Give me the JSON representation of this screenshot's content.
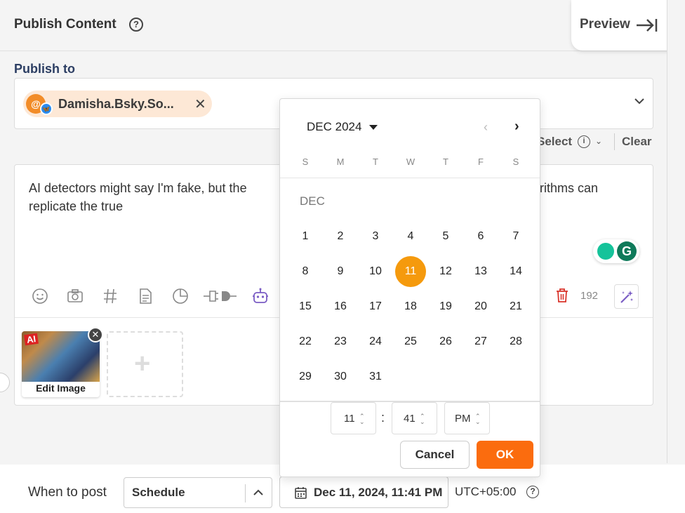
{
  "header": {
    "title": "Publish Content",
    "help_icon": "?",
    "preview_label": "Preview"
  },
  "publish_to": {
    "label": "Publish to",
    "account_name": "Damisha.Bsky.So...",
    "account_initial": "@",
    "close_glyph": "✕",
    "select_label": "Select",
    "info_glyph": "i",
    "clear_label": "Clear"
  },
  "editor": {
    "text": "AI detectors might say I'm fake, but the",
    "text_after": "rithms can",
    "text_line2": "replicate the true",
    "char_count": "192",
    "grammarly_g": "G",
    "toolbar_icons": [
      "emoji-icon",
      "camera-icon",
      "hashtag-icon",
      "document-icon",
      "pie-chart-icon",
      "plug-icon",
      "robot-icon"
    ]
  },
  "media": {
    "thumb_badge": "AI",
    "edit_label": "Edit Image",
    "remove_glyph": "✕",
    "add_glyph": "+"
  },
  "bottom": {
    "when_label": "When to post",
    "schedule_value": "Schedule",
    "date_value": "Dec 11, 2024, 11:41 PM",
    "timezone": "UTC+05:00",
    "tz_help": "?"
  },
  "picker": {
    "month_label": "DEC 2024",
    "prev_glyph": "‹",
    "next_glyph": "›",
    "weekdays": [
      "S",
      "M",
      "T",
      "W",
      "T",
      "F",
      "S"
    ],
    "section_label": "DEC",
    "days": [
      "1",
      "2",
      "3",
      "4",
      "5",
      "6",
      "7",
      "8",
      "9",
      "10",
      "11",
      "12",
      "13",
      "14",
      "15",
      "16",
      "17",
      "18",
      "19",
      "20",
      "21",
      "22",
      "23",
      "24",
      "25",
      "26",
      "27",
      "28",
      "29",
      "30",
      "31"
    ],
    "selected_day": "11",
    "hour": "11",
    "minute": "41",
    "ampm": "PM",
    "colon": ":",
    "spin_glyph": "⌃⌄",
    "cancel_label": "Cancel",
    "ok_label": "OK"
  },
  "colors": {
    "accent": "#fb6c0e",
    "selected_day": "#f59a0d",
    "publish_to": "#2c3e63"
  }
}
